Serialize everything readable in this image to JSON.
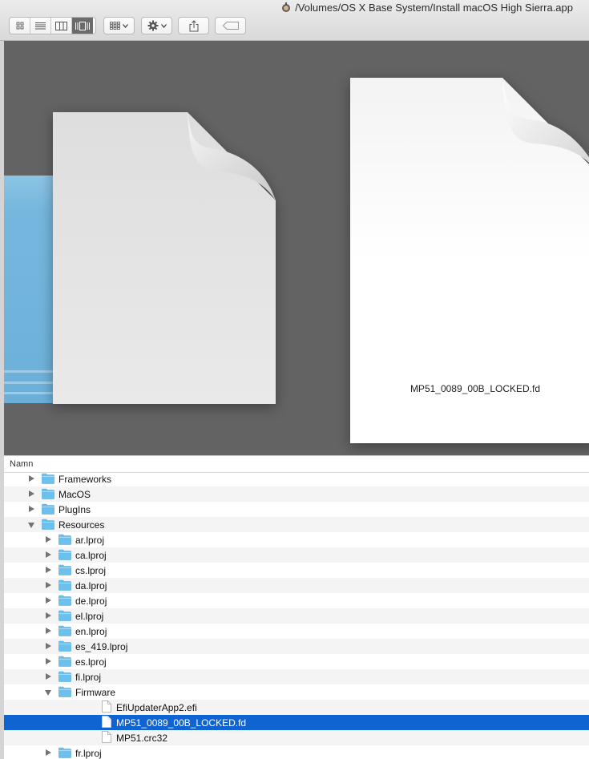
{
  "window": {
    "title": "/Volumes/OS X Base System/Install macOS High Sierra.app"
  },
  "toolbar": {
    "view_buttons": [
      {
        "name": "icon-view",
        "icon": "grid-icon"
      },
      {
        "name": "list-view",
        "icon": "list-icon"
      },
      {
        "name": "column-view",
        "icon": "columns-icon"
      },
      {
        "name": "cover-flow-view",
        "icon": "cover-flow-icon",
        "active": true
      }
    ],
    "arrange_icon": "arrange-grid-icon",
    "action_icon": "gear-icon",
    "share_icon": "share-icon",
    "tags_icon": "tag-icon"
  },
  "preview": {
    "selected_label": "MP51_0089_00B_LOCKED.fd",
    "background": "#636363"
  },
  "list": {
    "column_header": "Namn",
    "rows": [
      {
        "label": "Frameworks",
        "type": "folder",
        "level": 0,
        "expanded": false
      },
      {
        "label": "MacOS",
        "type": "folder",
        "level": 0,
        "expanded": false
      },
      {
        "label": "PlugIns",
        "type": "folder",
        "level": 0,
        "expanded": false
      },
      {
        "label": "Resources",
        "type": "folder",
        "level": 0,
        "expanded": true
      },
      {
        "label": "ar.lproj",
        "type": "folder",
        "level": 1,
        "expanded": false
      },
      {
        "label": "ca.lproj",
        "type": "folder",
        "level": 1,
        "expanded": false
      },
      {
        "label": "cs.lproj",
        "type": "folder",
        "level": 1,
        "expanded": false
      },
      {
        "label": "da.lproj",
        "type": "folder",
        "level": 1,
        "expanded": false
      },
      {
        "label": "de.lproj",
        "type": "folder",
        "level": 1,
        "expanded": false
      },
      {
        "label": "el.lproj",
        "type": "folder",
        "level": 1,
        "expanded": false
      },
      {
        "label": "en.lproj",
        "type": "folder",
        "level": 1,
        "expanded": false
      },
      {
        "label": "es_419.lproj",
        "type": "folder",
        "level": 1,
        "expanded": false
      },
      {
        "label": "es.lproj",
        "type": "folder",
        "level": 1,
        "expanded": false
      },
      {
        "label": "fi.lproj",
        "type": "folder",
        "level": 1,
        "expanded": false
      },
      {
        "label": "Firmware",
        "type": "folder",
        "level": 1,
        "expanded": true
      },
      {
        "label": "EfiUpdaterApp2.efi",
        "type": "file",
        "level": 2
      },
      {
        "label": "MP51_0089_00B_LOCKED.fd",
        "type": "file",
        "level": 2,
        "selected": true
      },
      {
        "label": "MP51.crc32",
        "type": "file",
        "level": 2
      },
      {
        "label": "fr.lproj",
        "type": "folder",
        "level": 1,
        "expanded": false
      }
    ]
  },
  "colors": {
    "selection": "#0f64d2",
    "folder": "#6cc0ee",
    "preview_bg": "#636363"
  }
}
